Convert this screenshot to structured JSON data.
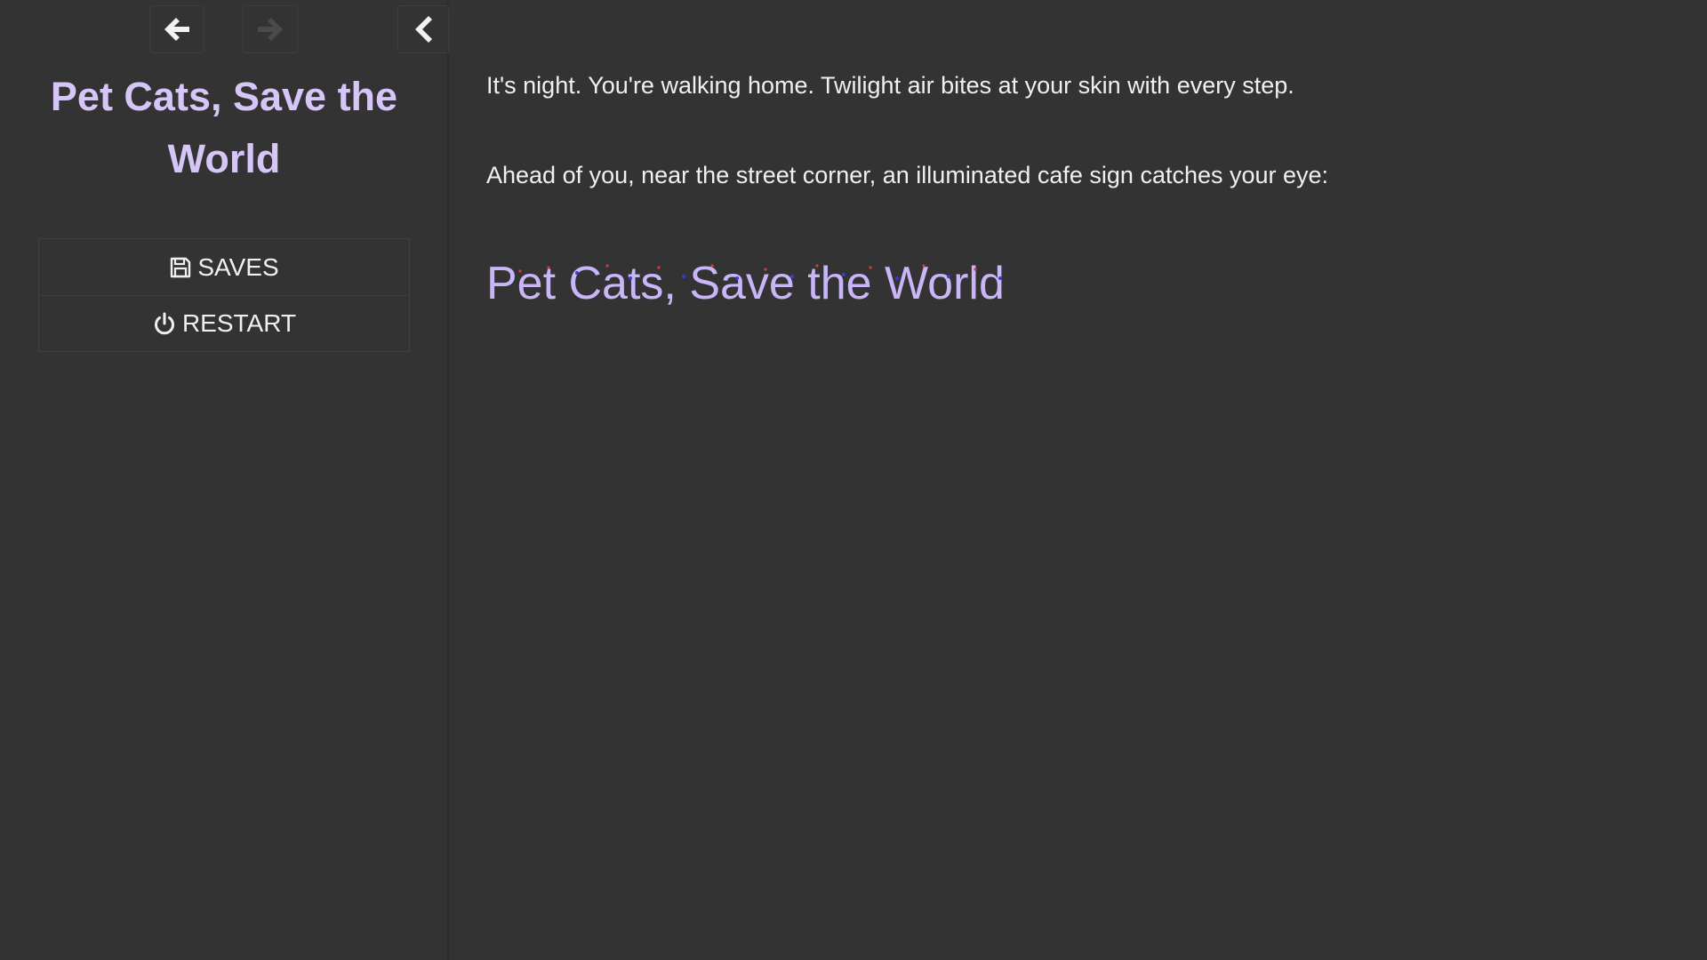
{
  "sidebar": {
    "title": "Pet Cats, Save the World",
    "menu": [
      {
        "label": "SAVES",
        "icon": "floppy-disk-icon"
      },
      {
        "label": "RESTART",
        "icon": "power-icon"
      }
    ],
    "nav": {
      "back_icon": "arrow-left-icon",
      "forward_icon": "arrow-right-icon",
      "collapse_icon": "chevron-left-icon"
    }
  },
  "passage": {
    "paragraphs": [
      "It's night. You're walking home. Twilight air bites at your skin with every step.",
      "Ahead of you, near the street corner, an illuminated cafe sign catches your eye:"
    ],
    "sign_text": "Pet Cats, Save the World"
  },
  "colors": {
    "background": "#333333",
    "title": "#d6c6f8",
    "sign": "#c8b6f8",
    "text": "#f0f0f0",
    "sparkle_blue": "#3a3ad8",
    "sparkle_red": "#d83a3a"
  }
}
